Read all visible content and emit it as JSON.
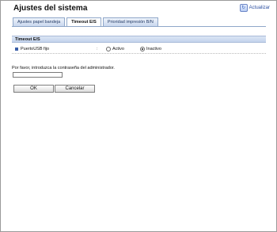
{
  "header": {
    "title": "Ajustes del sistema",
    "refresh_label": "Actualizar"
  },
  "tabs": [
    {
      "label": "Ajustes papel bandeja",
      "active": false
    },
    {
      "label": "Timeout E/S",
      "active": true
    },
    {
      "label": "Prioridad impresión B/N",
      "active": false
    }
  ],
  "section": {
    "title": "Timeout E/S"
  },
  "setting": {
    "label": "PuertoUSB fijo",
    "colon": ":",
    "options": [
      {
        "label": "Activo",
        "selected": false
      },
      {
        "label": "Inactivo",
        "selected": true
      }
    ]
  },
  "password": {
    "prompt": "Por favor, introduzca la contraseña del administrador.",
    "value": ""
  },
  "buttons": {
    "ok": "OK",
    "cancel": "Cancelar"
  },
  "colors": {
    "section_bg": "#c3d3ec",
    "tab_border": "#8fa7c9",
    "link": "#2c4fa0"
  }
}
